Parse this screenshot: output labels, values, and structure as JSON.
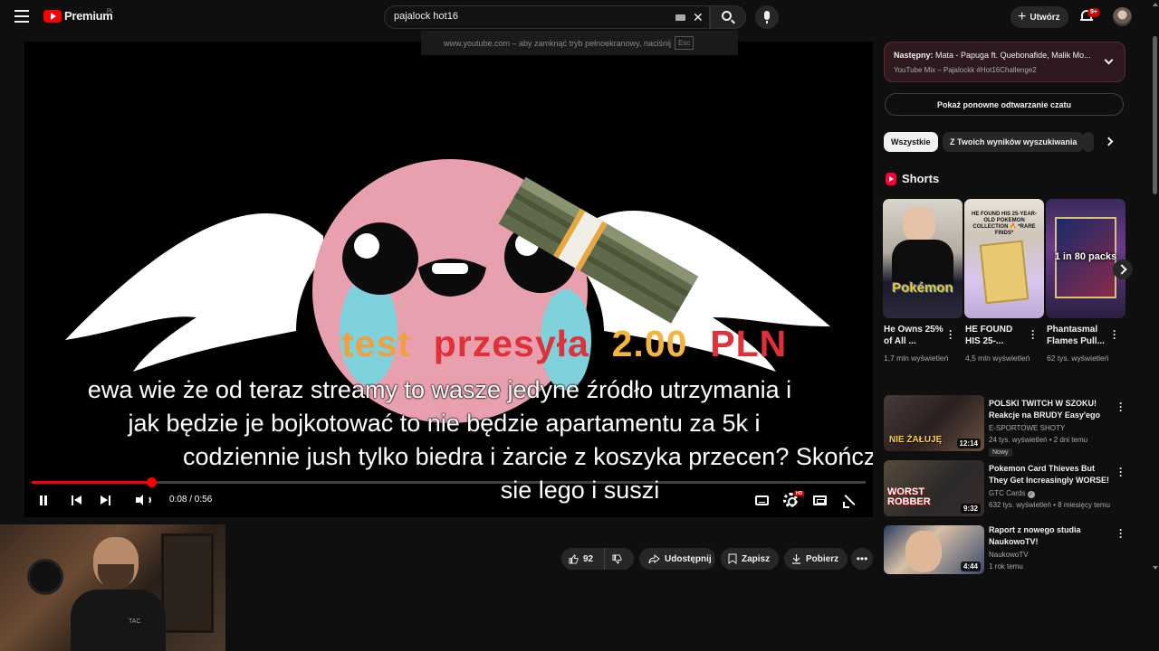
{
  "header": {
    "logo_text": "Premium",
    "region": "PL",
    "search_value": "pajalock hot16",
    "create_label": "Utwórz",
    "notifications_badge": "9+"
  },
  "player": {
    "fullscreen_hint": "www.youtube.com – aby zamknąć tryb pełnoekranowy, naciśnij",
    "fullscreen_key": "Esc",
    "donation": {
      "sender": "test",
      "verb": "przesyła",
      "amount": "2.00",
      "currency": "PLN"
    },
    "subtitles": [
      "ewa wie że od teraz streamy to wasze jedyne źródło utrzymania i",
      "jak będzie je bojkotować to nie będzie apartamentu za 5k i",
      "codziennie jush tylko biedra i żarcie z koszyka przecen? Skończy",
      "sie lego i suszi"
    ],
    "time": "0:08 / 0:56",
    "progress": 0.143,
    "hd_label": "HD",
    "colors": {
      "progress": "#ff0000",
      "donation_accent": "#e0303a",
      "donation_gold": "#f5b340"
    }
  },
  "webcam": {
    "shirt_text": "TAC"
  },
  "actions": {
    "like_count": "92",
    "share_label": "Udostępnij",
    "save_label": "Zapisz",
    "download_label": "Pobierz"
  },
  "sidebar": {
    "next_prefix": "Następny:",
    "next_title": "Mata - Papuga ft. Quebonafide, Malik Mo...",
    "next_sub": "YouTube Mix – Pajalockk #Hot16Challenge2",
    "replay_label": "Pokaż ponowne odtwarzanie czatu",
    "chips": [
      "Wszystkie",
      "Z Twoich wyników wyszukiwania",
      "Z"
    ],
    "shorts_heading": "Shorts",
    "shorts": [
      {
        "title": "He Owns 25% of All ...",
        "views": "1,7 mln wyświetleń",
        "thumb_text": "Pokémon"
      },
      {
        "title": "HE FOUND HIS 25-...",
        "views": "4,5 mln wyświetleń",
        "thumb_text": "HE FOUND HIS 25-YEAR-OLD POKEMON COLLECTION 🔥 *RARE FINDS*"
      },
      {
        "title": "Phantasmal Flames Pull...",
        "views": "62 tys. wyświetleń",
        "thumb_text": "1 in 80 packs"
      }
    ],
    "videos": [
      {
        "title": "POLSKI TWITCH W SZOKU! Reakcje na BRUDY Easy'ego",
        "channel": "E-SPORTOWE SHOTY",
        "meta": "24 tys. wyświetleń • 2 dni temu",
        "duration": "12:14",
        "badge": "Nowy",
        "thumb_text": "NIE ŻAŁUJĘ"
      },
      {
        "title": "Pokemon Card Thieves But They Get Increasingly WORSE!",
        "channel": "GTC Cards",
        "meta": "632 tys. wyświetleń • 8 miesięcy temu",
        "duration": "9:32",
        "thumb_text": "WORST ROBBER"
      },
      {
        "title": "Raport z nowego studia NaukowoTV!",
        "channel": "NaukowoTV",
        "meta": "1 rok temu",
        "duration": "4:44"
      }
    ]
  }
}
